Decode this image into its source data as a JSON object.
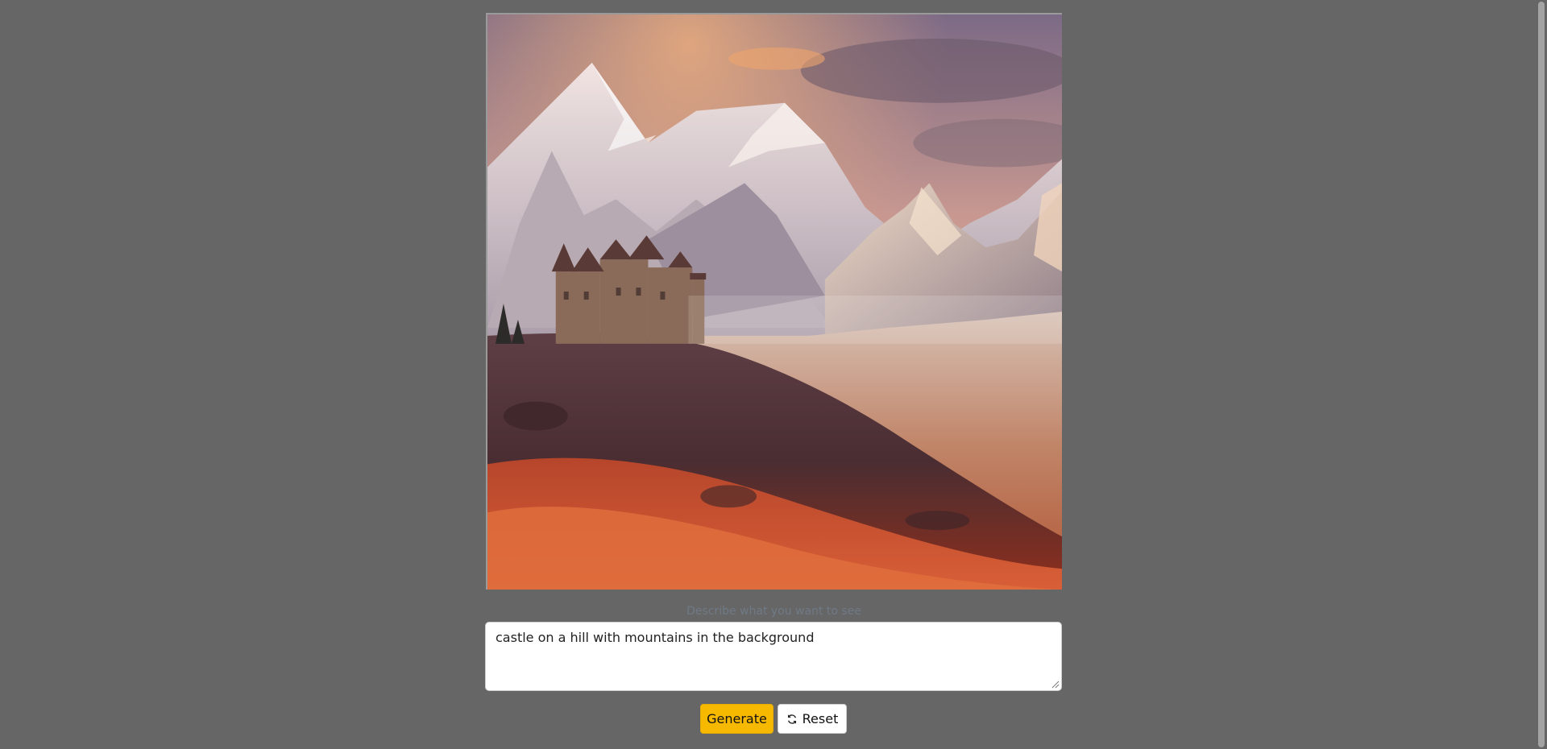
{
  "generated_image": {
    "alt": "castle on a hill with mountains in the background"
  },
  "prompt": {
    "hint": "Describe what you want to see",
    "value": "castle on a hill with mountains in the background"
  },
  "actions": {
    "generate_label": "Generate",
    "reset_label": "Reset",
    "reset_icon": "refresh-icon"
  },
  "colors": {
    "background": "#666666",
    "generate_button": "#f7b900"
  }
}
